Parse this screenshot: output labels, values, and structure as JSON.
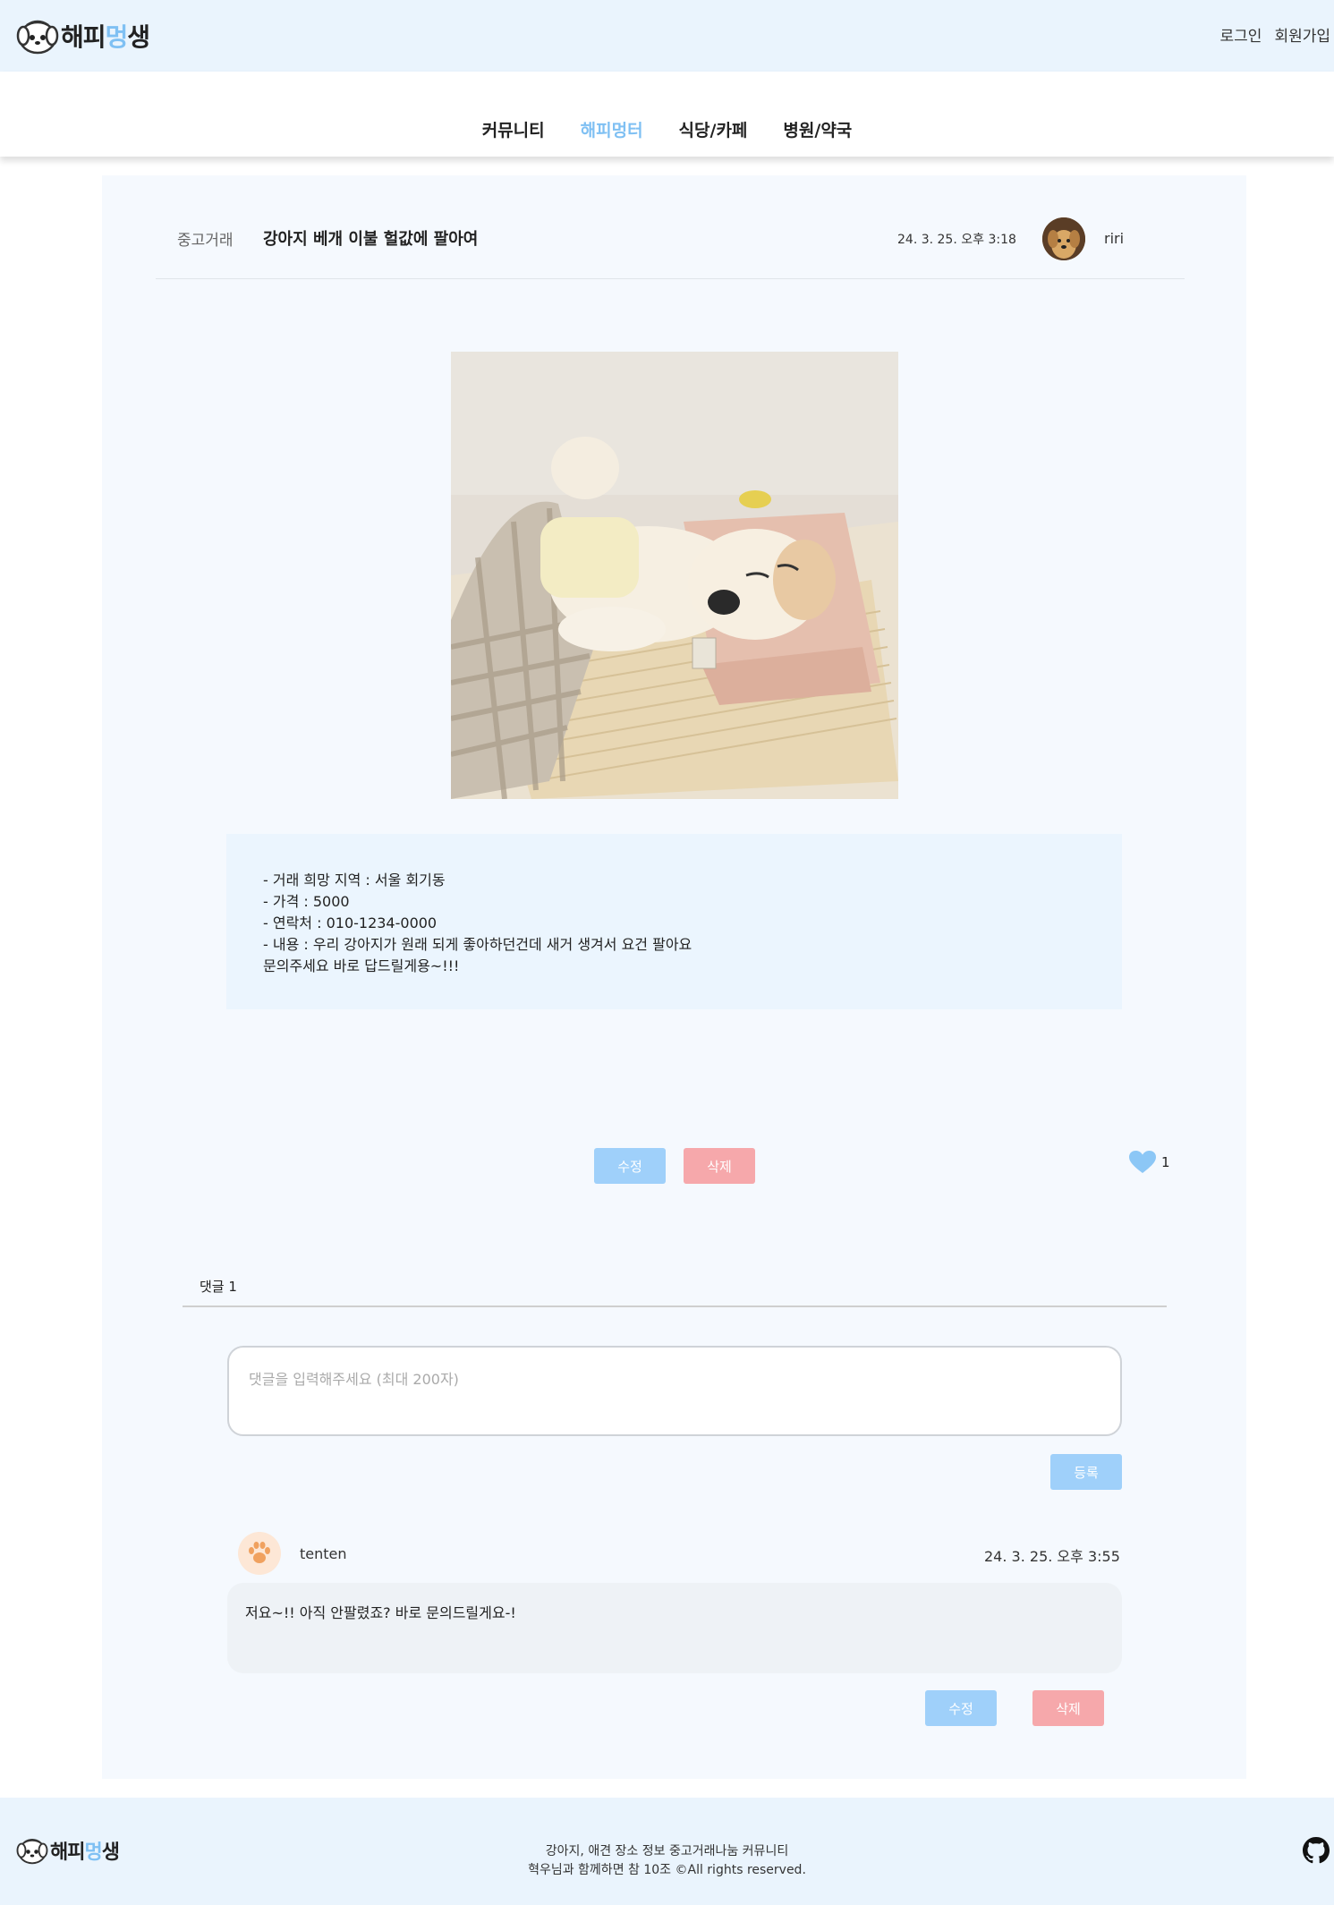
{
  "header": {
    "logo": {
      "text_main": "해피",
      "text_accent": "멍",
      "text_end": "생"
    },
    "auth": {
      "login": "로그인",
      "signup": "회원가입"
    },
    "nav": [
      {
        "label": "커뮤니티",
        "active": false
      },
      {
        "label": "해피멍터",
        "active": true
      },
      {
        "label": "식당/카페",
        "active": false
      },
      {
        "label": "병원/약국",
        "active": false
      }
    ]
  },
  "post": {
    "category": "중고거래",
    "title": "강아지 베개 이불 헐값에 팔아여",
    "date": "24. 3. 25. 오후 3:18",
    "author": "riri",
    "content_lines": [
      "- 거래 희망 지역 : 서울 회기동",
      "- 가격 : 5000",
      "- 연락처 : 010-1234-0000",
      "- 내용 : 우리 강아지가 원래 되게 좋아하던건데 새거 생겨서 요건 팔아요",
      "문의주세요 바로 답드릴게용~!!!"
    ],
    "edit_label": "수정",
    "delete_label": "삭제",
    "like_count": "1"
  },
  "comments": {
    "count_label": "댓글 1",
    "input_placeholder": "댓글을 입력해주세요 (최대 200자)",
    "submit_label": "등록",
    "items": [
      {
        "author": "tenten",
        "date": "24. 3. 25. 오후 3:55",
        "text": "저요~!! 아직 안팔렸죠? 바로 문의드릴게요-!",
        "edit_label": "수정",
        "delete_label": "삭제"
      }
    ]
  },
  "footer": {
    "logo": {
      "text_main": "해피",
      "text_accent": "멍",
      "text_end": "생"
    },
    "line1": "강아지, 애견 장소 정보 중고거래나눔 커뮤니티",
    "line2": "혁우님과 함께하면 참 10조 ©All rights reserved."
  },
  "colors": {
    "accent": "#7fc0f3",
    "header_bg": "#eaf4fd",
    "btn_blue": "#9fd0fa",
    "btn_red": "#f6a8ab"
  }
}
